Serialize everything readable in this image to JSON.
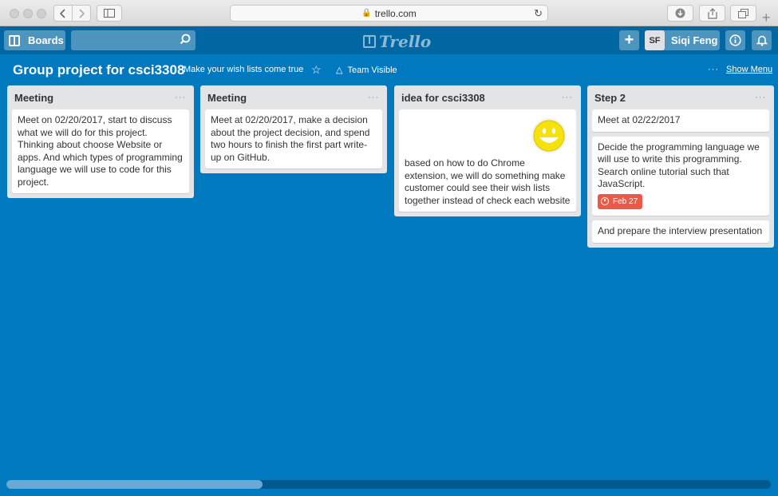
{
  "browser": {
    "url": "trello.com"
  },
  "header": {
    "boards_label": "Boards",
    "search_value": "",
    "logo_text": "Trello",
    "add_label": "+",
    "member_initials": "SF",
    "member_name": "Siqi Feng",
    "info_label": "i"
  },
  "board": {
    "title": "Group project for csci3308",
    "description": "Make your wish lists come true",
    "visibility": "Team Visible",
    "menu_dots": "···",
    "show_menu": "Show Menu"
  },
  "lists": [
    {
      "title": "Meeting",
      "menu": "···",
      "cards": [
        {
          "text": "Meet on 02/20/2017, start to discuss what we will do for this project. Thinking about choose Website or apps. And which types of programming language we will use to code for this project."
        }
      ]
    },
    {
      "title": "Meeting",
      "menu": "···",
      "cards": [
        {
          "text": "Meet at 02/20/2017, make a decision about the project decision, and spend two hours to finish the first part write-up on GitHub."
        }
      ]
    },
    {
      "title": "idea for csci3308",
      "menu": "···",
      "cards": [
        {
          "text": "based on how to do Chrome extension, we will do something make customer could see their wish lists together instead of check each website",
          "cover": "smiley-icon"
        }
      ]
    },
    {
      "title": "Step 2",
      "menu": "···",
      "cards": [
        {
          "text": "Meet at 02/22/2017"
        },
        {
          "text": "Decide the programming language we will use to write this programming. Search online tutorial such that JavaScript.",
          "badge": "Feb 27",
          "badge_color": "#eb5a46"
        },
        {
          "text": "And prepare the interview presentation"
        }
      ]
    }
  ],
  "scrollbar": {
    "position_fraction": 0.0,
    "visible_fraction": 0.33
  },
  "colors": {
    "board_background": "#0079bf",
    "header_background": "#0067a3",
    "list_background": "#e2e4e6",
    "due_badge": "#eb5a46"
  }
}
